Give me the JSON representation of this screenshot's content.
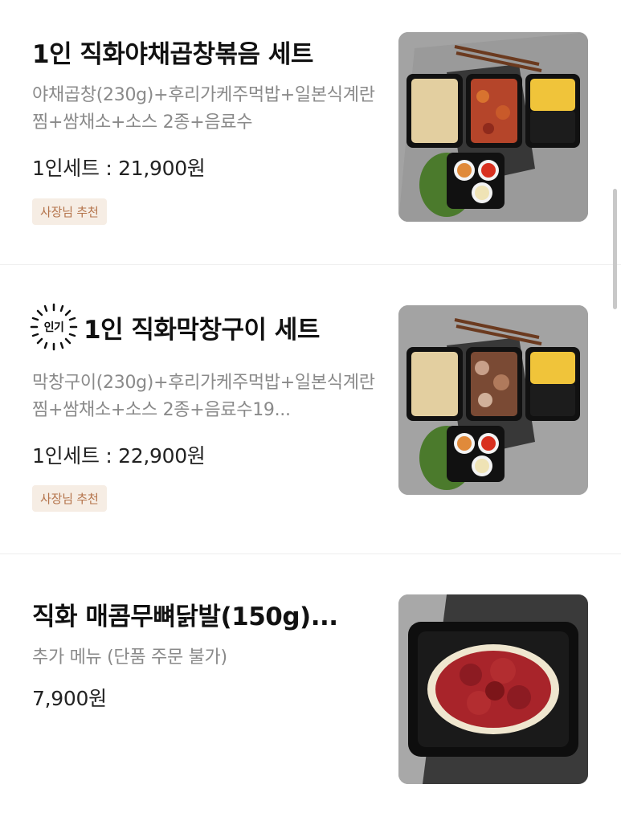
{
  "items": [
    {
      "title": "1인 직화야채곱창볶음 세트",
      "description": "야채곱창(230g)+후리가케주먹밥+일본식계란찜+쌈채소+소스 2종+음료수",
      "price": "1인세트 : 21,900원",
      "badge": "사장님 추천"
    },
    {
      "popular_label": "인기",
      "title": "1인 직화막창구이 세트",
      "description": "막창구이(230g)+후리가케주먹밥+일본식계란찜+쌈채소+소스 2종+음료수19...",
      "price": "1인세트 : 22,900원",
      "badge": "사장님 추천"
    },
    {
      "title": "직화 매콤무뼈닭발(150g)...",
      "description": "추가 메뉴 (단품 주문 불가)",
      "price": "7,900원"
    }
  ],
  "colors": {
    "badge_bg": "#f6ede4",
    "badge_text": "#b4734a",
    "description": "#8a8a8a"
  }
}
